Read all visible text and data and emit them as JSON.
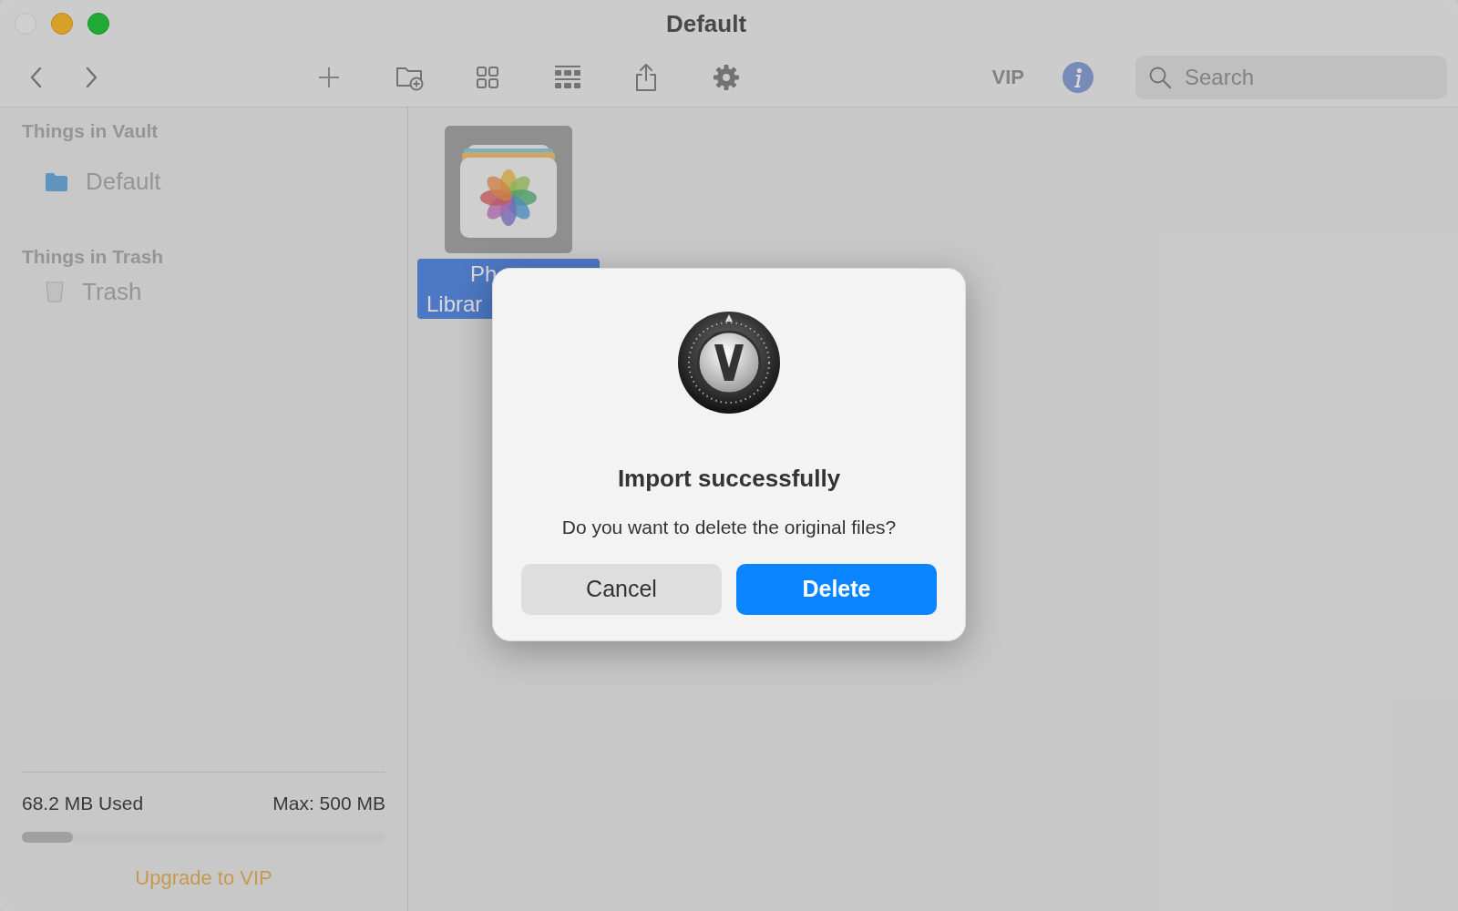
{
  "window": {
    "title": "Default"
  },
  "toolbar": {
    "vip": "VIP",
    "search": {
      "placeholder": "Search"
    }
  },
  "sidebar": {
    "sections": [
      {
        "heading": "Things in Vault",
        "items": [
          {
            "label": "Default",
            "kind": "folder"
          }
        ]
      },
      {
        "heading": "Things in Trash",
        "items": [
          {
            "label": "Trash",
            "kind": "trash"
          }
        ]
      }
    ],
    "storage": {
      "used": "68.2 MB Used",
      "max": "Max: 500 MB",
      "level": 0.14
    },
    "upgrade": "Upgrade to VIP"
  },
  "files": [
    {
      "label_lines": [
        "Ph",
        "Librar"
      ],
      "selected": true
    }
  ],
  "dialog": {
    "title": "Import successfully",
    "message": "Do you want to delete the original files?",
    "buttons": [
      {
        "label": "Cancel",
        "kind": "secondary"
      },
      {
        "label": "Delete",
        "kind": "primary"
      }
    ]
  }
}
